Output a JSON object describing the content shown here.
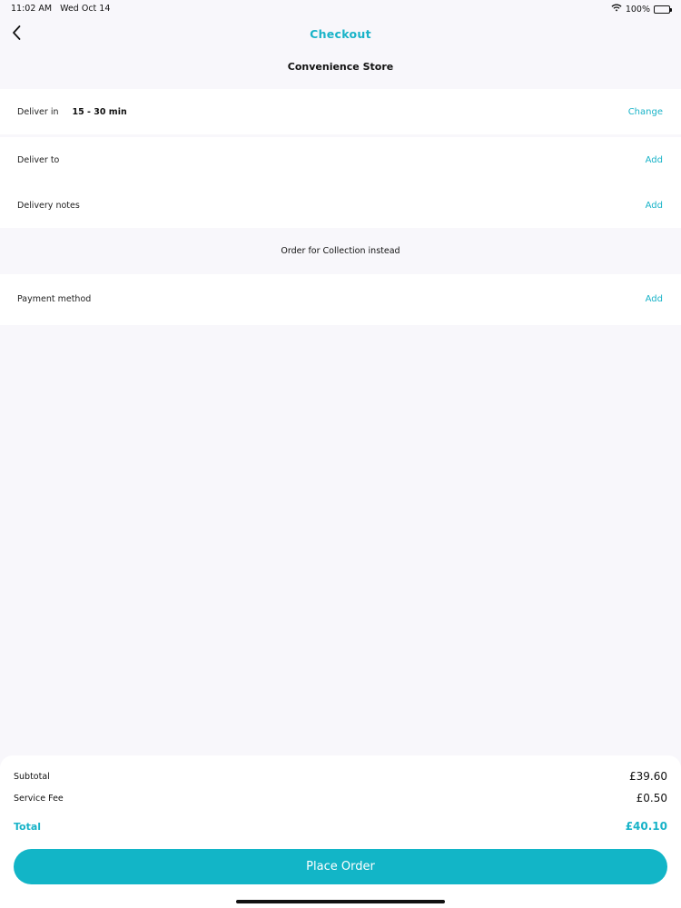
{
  "status_bar": {
    "time": "11:02 AM",
    "date": "Wed Oct 14",
    "battery": "100%"
  },
  "nav": {
    "title": "Checkout",
    "store_name": "Convenience Store"
  },
  "delivery": {
    "deliver_in_label": "Deliver in",
    "deliver_in_value": "15 - 30 min",
    "deliver_in_action": "Change",
    "deliver_to_label": "Deliver to",
    "deliver_to_action": "Add",
    "notes_label": "Delivery notes",
    "notes_action": "Add"
  },
  "collection_label": "Order for Collection instead",
  "payment": {
    "label": "Payment method",
    "action": "Add"
  },
  "summary": {
    "subtotal_label": "Subtotal",
    "subtotal_value": "£39.60",
    "service_fee_label": "Service Fee",
    "service_fee_value": "£0.50",
    "total_label": "Total",
    "total_value": "£40.10",
    "place_order_label": "Place Order"
  },
  "colors": {
    "accent": "#19b3c8",
    "button": "#12b5c7",
    "background": "#f8f7fb"
  },
  "icons": {
    "back": "chevron-left-icon",
    "wifi": "wifi-icon",
    "battery": "battery-icon"
  }
}
